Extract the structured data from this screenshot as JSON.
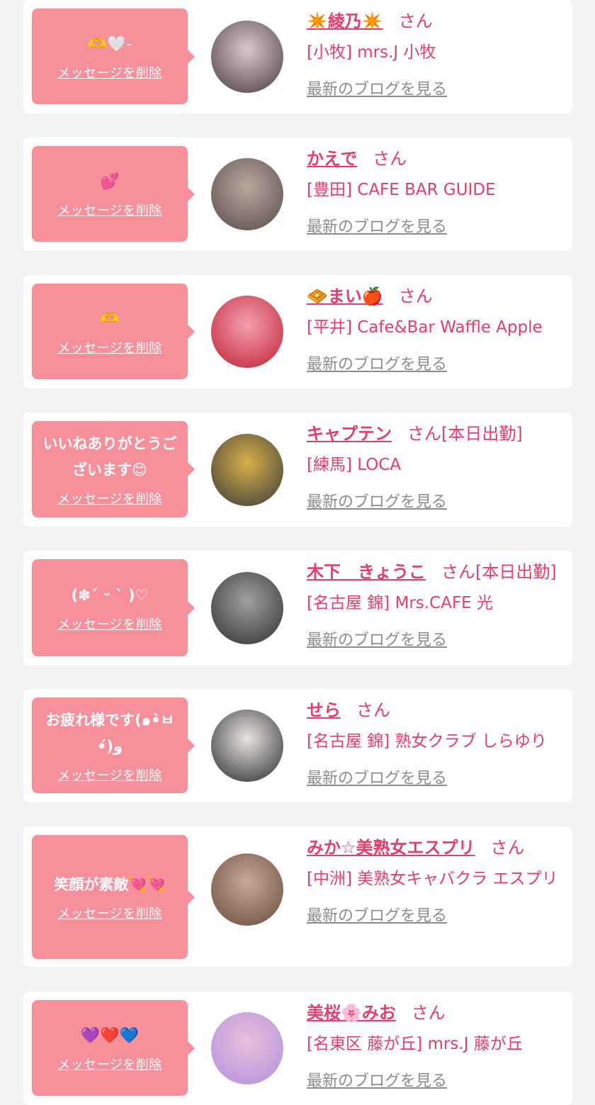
{
  "delete_label": "メッセージを削除",
  "blog_label": "最新のブログを見る",
  "san_label": "さん",
  "colors": {
    "background": "#f2f2f2",
    "bubble": "#f7909b",
    "accent": "#e33e6c",
    "link_gray": "#8c8c8c"
  },
  "items": [
    {
      "message": "🫶🤍-",
      "emoji_only": true,
      "name": "✴️綾乃✴️",
      "status": "",
      "shop": "[小牧] mrs.J 小牧",
      "avatar_colors": [
        "#d8c8d0",
        "#4a3a40"
      ]
    },
    {
      "message": "💕",
      "emoji_only": true,
      "name": "かえで",
      "status": "",
      "shop": "[豊田] CAFE BAR GUIDE",
      "avatar_colors": [
        "#b7a8a0",
        "#5a4a44"
      ]
    },
    {
      "message": "🫶",
      "emoji_only": true,
      "name": "🧇まい🍎",
      "status": "",
      "shop": "[平井] Cafe&Bar Waffle Apple",
      "avatar_colors": [
        "#f2a0b0",
        "#c02030"
      ]
    },
    {
      "message": "いいねありがとうございます😊",
      "emoji_only": false,
      "name": "キャプテン",
      "status": "[本日出勤]",
      "shop": "[練馬] LOCA",
      "avatar_colors": [
        "#d8b04a",
        "#3a3a3a"
      ]
    },
    {
      "message": "(✽´ ᵕ ` )♡",
      "emoji_only": false,
      "name": "木下　きょうこ",
      "status": "[本日出勤]",
      "shop": "[名古屋 錦] Mrs.CAFE 光",
      "avatar_colors": [
        "#a0a0a0",
        "#303030"
      ]
    },
    {
      "message": "お疲れ様です(๑•̀ㅂ•́)و",
      "emoji_only": false,
      "name": "せら",
      "status": "",
      "shop": "[名古屋 錦] 熟女クラブ しらゆり",
      "avatar_colors": [
        "#e8e4e2",
        "#2a2a2a"
      ]
    },
    {
      "message": "笑顔が素敵💘💘",
      "emoji_only": false,
      "name": "みか☆美熟女エスプリ",
      "status": "",
      "shop": "[中洲] 美熟女キャバクラ エスプリ",
      "avatar_colors": [
        "#c8a898",
        "#6a4a3a"
      ]
    },
    {
      "message": "💜❤️💙",
      "emoji_only": true,
      "name": "美桜🌸みお",
      "status": "",
      "shop": "[名東区 藤が丘] mrs.J 藤が丘",
      "avatar_colors": [
        "#e8c0d8",
        "#b090e0"
      ]
    }
  ]
}
